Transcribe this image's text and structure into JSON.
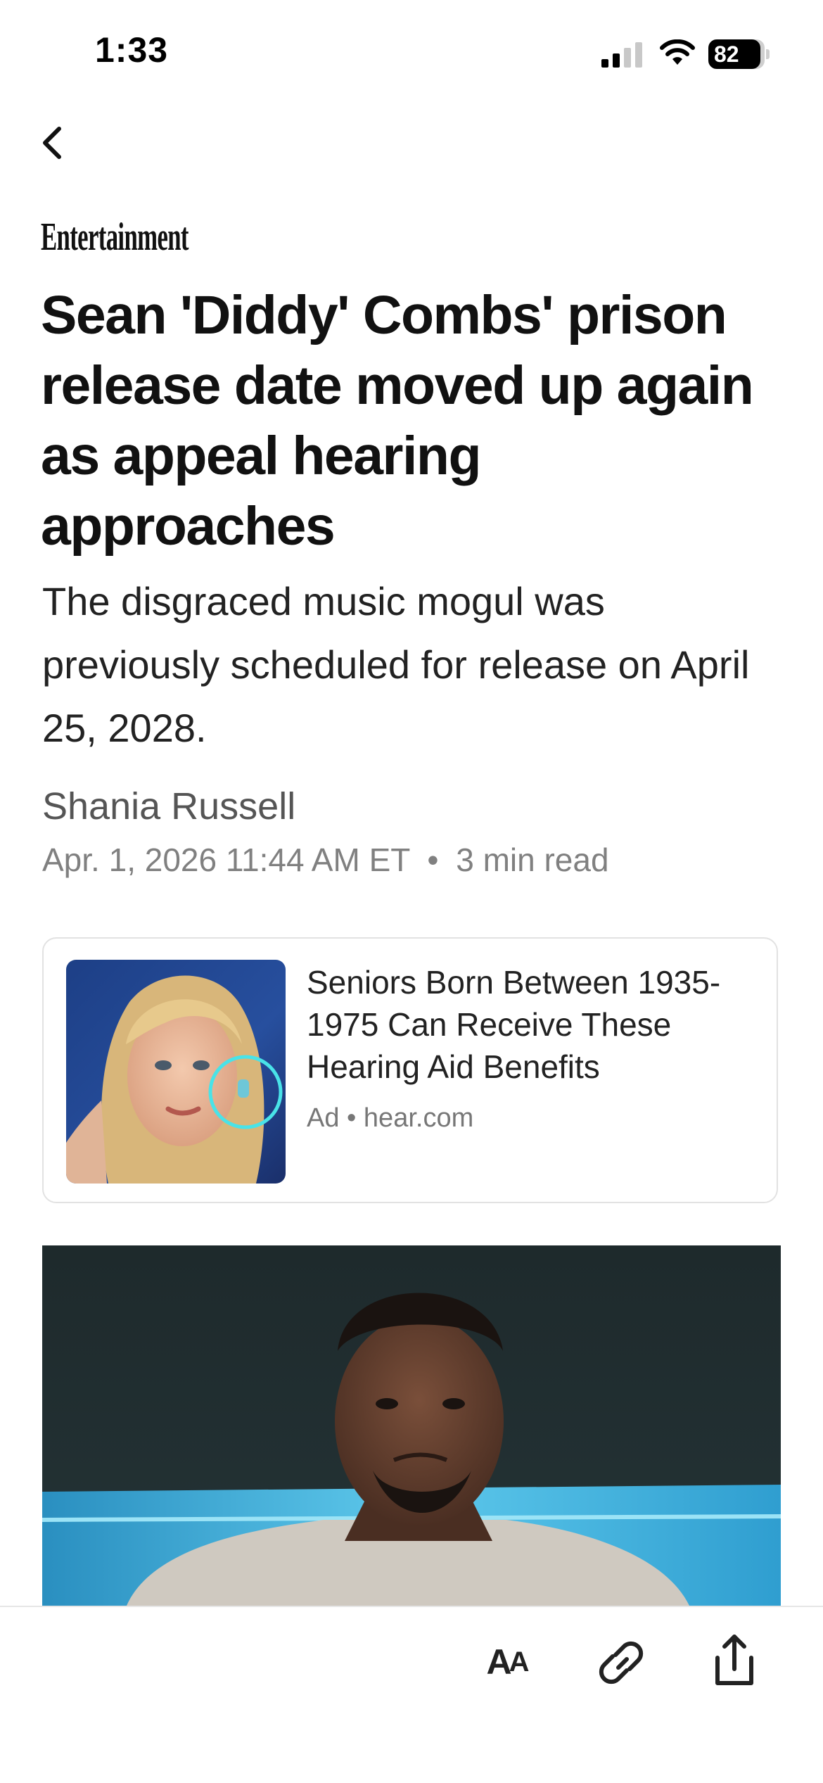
{
  "status_bar": {
    "time": "1:33",
    "battery_percent": "82",
    "signal_bars": 2,
    "signal_bars_max": 4,
    "icons": [
      "cellular-signal-icon",
      "wifi-icon",
      "battery-icon"
    ]
  },
  "nav": {
    "back_icon": "chevron-left-icon"
  },
  "article": {
    "publisher": "Entertainment",
    "headline": "Sean 'Diddy' Combs' prison release date moved up again as appeal hearing approaches",
    "subheadline": "The disgraced music mogul was previously scheduled for release on April 25, 2028.",
    "author": "Shania Russell",
    "date": "Apr. 1, 2026 11:44 AM ET",
    "separator": "•",
    "read_time": "3 min read"
  },
  "ad": {
    "title": "Seniors Born Between 1935-1975 Can Receive These Hearing Aid Benefits",
    "label": "Ad",
    "separator": "•",
    "source": "hear.com"
  },
  "toolbar": {
    "text_size_label_large": "A",
    "text_size_label_small": "A",
    "icons": [
      "text-size-icon",
      "link-icon",
      "share-icon"
    ]
  },
  "colors": {
    "text_primary": "#111111",
    "text_secondary": "#555555",
    "text_muted": "#808080",
    "border": "#e2e2e2",
    "ad_ring": "#49e3e8"
  }
}
